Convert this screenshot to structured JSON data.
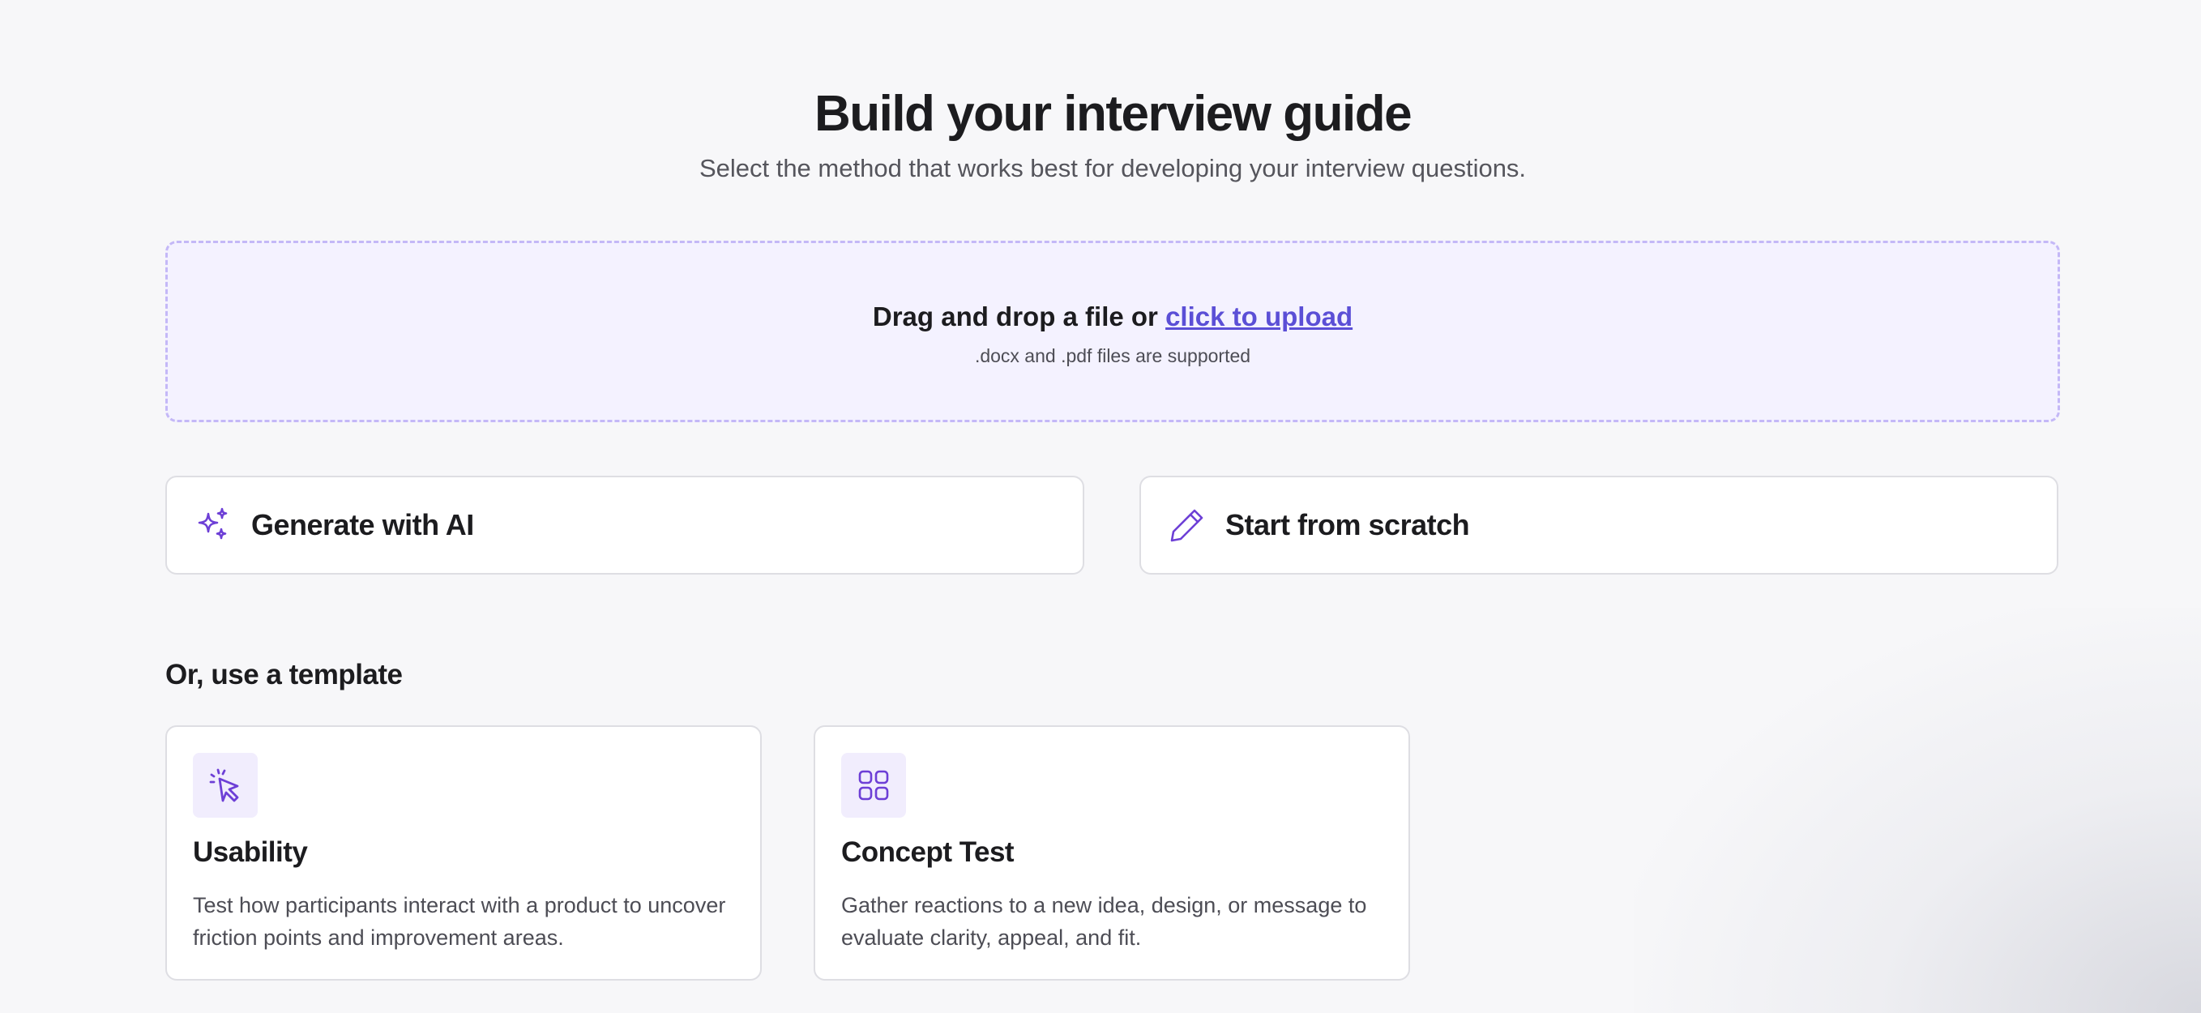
{
  "header": {
    "title": "Build your interview guide",
    "subtitle": "Select the method that works best for developing your interview questions."
  },
  "upload": {
    "prompt_prefix": "Drag and drop a file or ",
    "link_label": "click to upload",
    "hint": ".docx and .pdf files are supported"
  },
  "actions": [
    {
      "label": "Generate with AI",
      "icon": "sparkles-icon"
    },
    {
      "label": "Start from scratch",
      "icon": "pencil-icon"
    }
  ],
  "templates_section": {
    "heading": "Or, use a template",
    "items": [
      {
        "title": "Usability",
        "description": "Test how participants interact with a product to uncover friction points and improvement areas.",
        "icon": "cursor-click-icon"
      },
      {
        "title": "Concept Test",
        "description": "Gather reactions to a new idea, design, or message to evaluate clarity, appeal, and fit.",
        "icon": "grid-four-icon"
      }
    ]
  },
  "colors": {
    "accent": "#6d3fd6",
    "link": "#5b4fd6",
    "dropzone_bg": "#f4f2ff",
    "dropzone_border": "#c4b8f7",
    "icon_tile_bg": "#f1edfd"
  }
}
